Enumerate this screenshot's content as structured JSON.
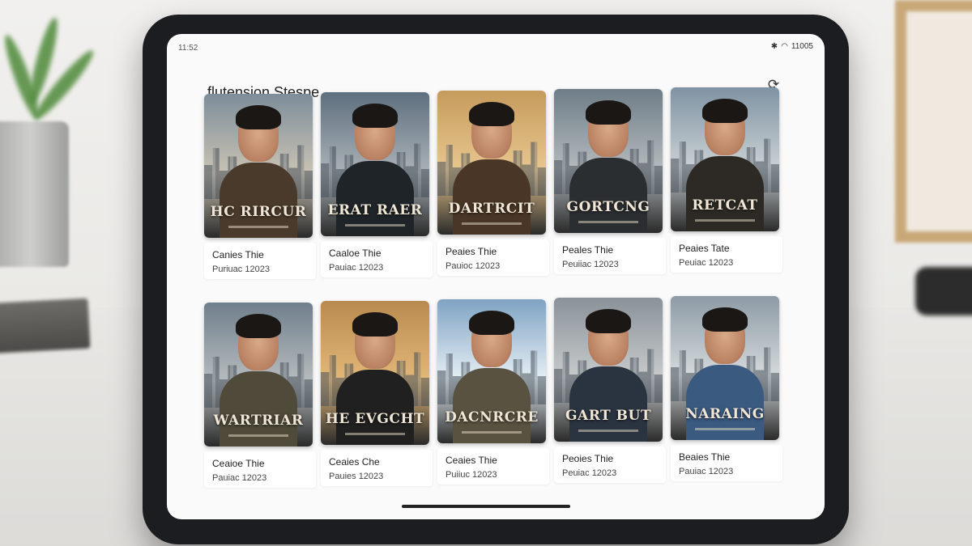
{
  "status": {
    "time": "11:52",
    "battery": "11005"
  },
  "app": {
    "title": "flutension Stespe"
  },
  "icons": {
    "refresh": "refresh-icon",
    "bluetooth": "bluetooth-icon",
    "wifi": "wifi-icon"
  },
  "rows": [
    [
      {
        "poster_title": "HC RIRCUR",
        "title": "Canies Thie",
        "subtitle": "Puriuac 12023"
      },
      {
        "poster_title": "ERAT RAER",
        "title": "Caaloe Thie",
        "subtitle": "Pauiac 12023"
      },
      {
        "poster_title": "DARTRCIT",
        "title": "Peaies Thie",
        "subtitle": "Pauioc 12023"
      },
      {
        "poster_title": "GORTCNG",
        "title": "Peales Thie",
        "subtitle": "Peuiiac 12023"
      },
      {
        "poster_title": "RETCAT",
        "title": "Peaies Tate",
        "subtitle": "Peuiac 12023"
      }
    ],
    [
      {
        "poster_title": "WARTRIAR",
        "title": "Ceaioe Thie",
        "subtitle": "Pauiac 12023"
      },
      {
        "poster_title": "HE EVGCHT",
        "title": "Ceaies Che",
        "subtitle": "Pauies 12023"
      },
      {
        "poster_title": "DACNRCRE",
        "title": "Ceaies Thie",
        "subtitle": "Puiiuc 12023"
      },
      {
        "poster_title": "GART BUT",
        "title": "Peoies Thie",
        "subtitle": "Peuiac 12023"
      },
      {
        "poster_title": "NARAING",
        "title": "Beaies Thie",
        "subtitle": "Pauiac 12023"
      }
    ]
  ]
}
